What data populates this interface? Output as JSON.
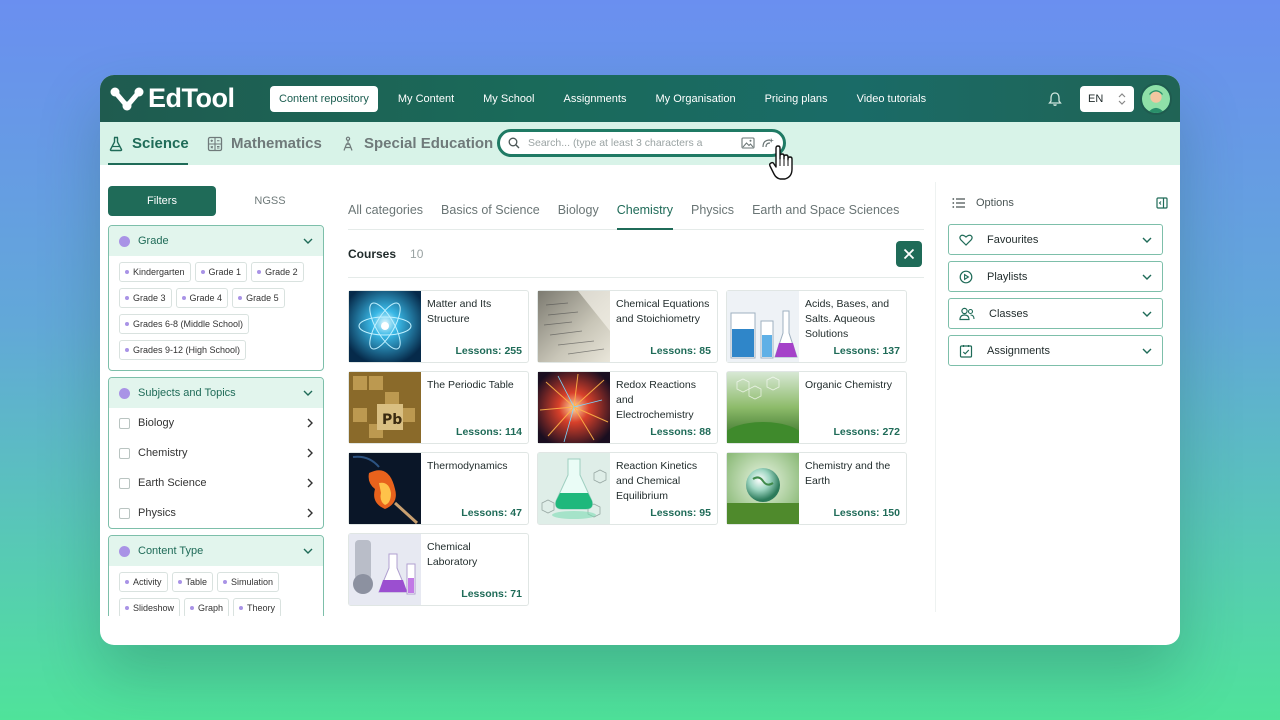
{
  "app": {
    "logo_text": "EdTool"
  },
  "nav": {
    "items": [
      {
        "label": "Content repository",
        "active": true
      },
      {
        "label": "My Content"
      },
      {
        "label": "My School"
      },
      {
        "label": "Assignments"
      },
      {
        "label": "My Organisation"
      },
      {
        "label": "Pricing plans"
      },
      {
        "label": "Video tutorials"
      }
    ],
    "language": "EN"
  },
  "subjects": [
    {
      "label": "Science",
      "icon": "flask-icon",
      "active": true
    },
    {
      "label": "Mathematics",
      "icon": "calculator-icon"
    },
    {
      "label": "Special Education",
      "icon": "special-education-icon"
    }
  ],
  "search": {
    "placeholder": "Search... (type at least 3 characters a"
  },
  "filters": {
    "tabs": [
      {
        "label": "Filters",
        "active": true
      },
      {
        "label": "NGSS"
      }
    ],
    "grade": {
      "title": "Grade",
      "chips": [
        "Kindergarten",
        "Grade 1",
        "Grade 2",
        "Grade 3",
        "Grade 4",
        "Grade 5",
        "Grades 6-8 (Middle School)",
        "Grades 9-12 (High School)"
      ]
    },
    "subjects_topics": {
      "title": "Subjects and Topics",
      "items": [
        "Biology",
        "Chemistry",
        "Earth Science",
        "Physics"
      ]
    },
    "content_type": {
      "title": "Content Type",
      "chips": [
        "Activity",
        "Table",
        "Simulation",
        "Slideshow",
        "Graph",
        "Theory"
      ]
    }
  },
  "categories": [
    {
      "label": "All categories"
    },
    {
      "label": "Basics of Science"
    },
    {
      "label": "Biology"
    },
    {
      "label": "Chemistry",
      "active": true
    },
    {
      "label": "Physics"
    },
    {
      "label": "Earth and Space Sciences"
    }
  ],
  "courses": {
    "title": "Courses",
    "count": "10",
    "items": [
      {
        "title": "Matter and Its Structure",
        "lessons": "Lessons: 255",
        "thumb": "atom"
      },
      {
        "title": "Chemical Equations and Stoichiometry",
        "lessons": "Lessons: 85",
        "thumb": "paper"
      },
      {
        "title": "Acids, Bases, and Salts. Aqueous Solutions",
        "lessons": "Lessons: 137",
        "thumb": "beakers"
      },
      {
        "title": "The Periodic Table",
        "lessons": "Lessons: 114",
        "thumb": "periodic"
      },
      {
        "title": "Redox Reactions and Electrochemistry",
        "lessons": "Lessons: 88",
        "thumb": "sparks"
      },
      {
        "title": "Organic Chemistry",
        "lessons": "Lessons: 272",
        "thumb": "moss"
      },
      {
        "title": "Thermodynamics",
        "lessons": "Lessons: 47",
        "thumb": "fire"
      },
      {
        "title": "Reaction Kinetics and Chemical Equilibrium",
        "lessons": "Lessons: 95",
        "thumb": "flask"
      },
      {
        "title": "Chemistry and the Earth",
        "lessons": "Lessons: 150",
        "thumb": "globe"
      },
      {
        "title": "Chemical Laboratory",
        "lessons": "Lessons: 71",
        "thumb": "lab"
      }
    ]
  },
  "options": {
    "title": "Options",
    "items": [
      {
        "label": "Favourites",
        "icon": "heart-icon"
      },
      {
        "label": "Playlists",
        "icon": "play-circle-icon"
      },
      {
        "label": "Classes",
        "icon": "users-icon"
      },
      {
        "label": "Assignments",
        "icon": "clipboard-check-icon"
      }
    ]
  },
  "colors": {
    "accent": "#1f6b58",
    "topbar": "#1f5b4f",
    "subject_bar": "#d8f3e8",
    "dot": "#a993e6"
  }
}
